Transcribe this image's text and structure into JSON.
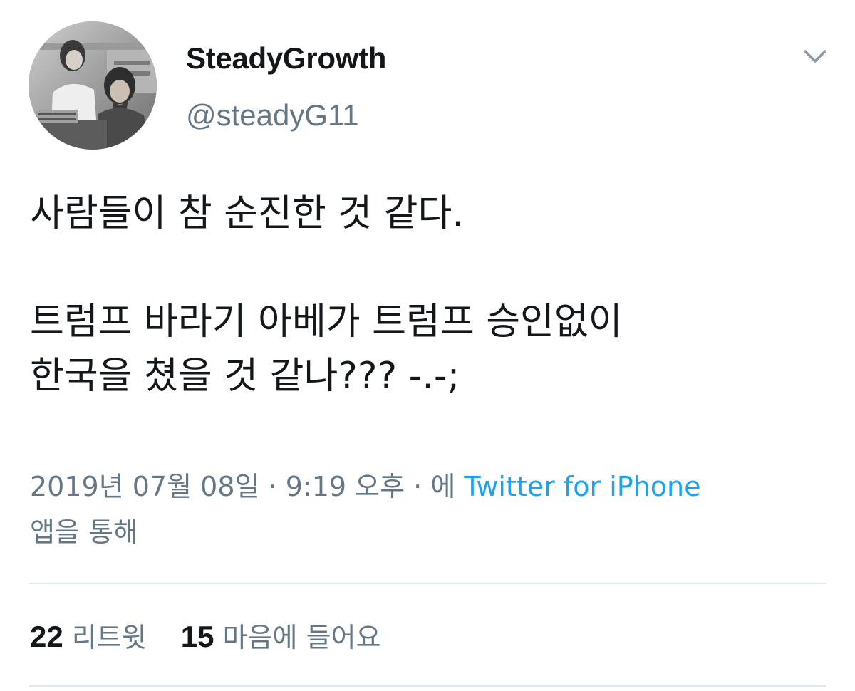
{
  "author": {
    "display_name": "SteadyGrowth",
    "handle": "@steadyG11",
    "avatar_icon": "avatar-photo"
  },
  "menu": {
    "icon": "chevron-down-icon"
  },
  "tweet": {
    "paragraphs": [
      "사람들이 참 순진한 것 같다.",
      "트럼프 바라기 아베가 트럼프 승인없이\n한국을 쳤을 것 같나??? -.-;"
    ]
  },
  "meta": {
    "date": "2019년 07월 08일",
    "separator": "·",
    "time": "9:19 오후",
    "source_prefix": "에",
    "source": "Twitter for iPhone",
    "source_suffix": "앱을 통해"
  },
  "stats": {
    "retweets_count": "22",
    "retweets_label": "리트윗",
    "likes_count": "15",
    "likes_label": "마음에 들어요"
  },
  "colors": {
    "text_primary": "#14171a",
    "text_secondary": "#657786",
    "link": "#1da1f2",
    "divider": "#e1e8ed"
  }
}
